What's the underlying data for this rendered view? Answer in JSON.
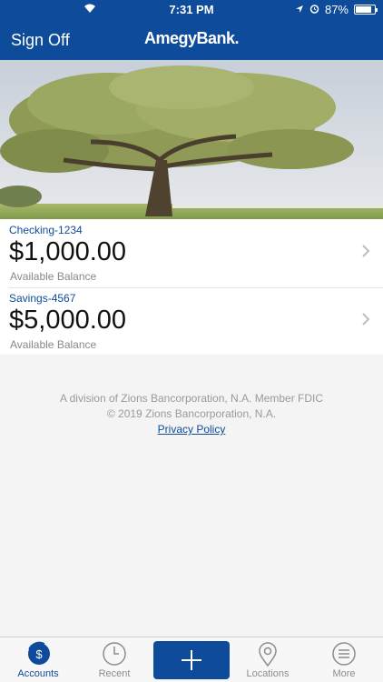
{
  "status_bar": {
    "time": "7:31 PM",
    "battery_percent": "87%",
    "battery_level": 0.87
  },
  "navbar": {
    "sign_off_label": "Sign Off",
    "logo_text": "AmegyBank."
  },
  "accounts": [
    {
      "name": "Checking-1234",
      "balance": "$1,000.00",
      "balance_label": "Available Balance"
    },
    {
      "name": "Savings-4567",
      "balance": "$5,000.00",
      "balance_label": "Available Balance"
    }
  ],
  "footer": {
    "line1": "A division of Zions Bancorporation, N.A. Member FDIC",
    "line2": "© 2019 Zions Bancorporation, N.A.",
    "privacy_link": "Privacy Policy"
  },
  "tabbar": {
    "tabs": [
      {
        "label": "Accounts",
        "icon": "dollar-circle-icon",
        "active": true
      },
      {
        "label": "Recent",
        "icon": "clock-icon",
        "active": false
      },
      {
        "label": "",
        "icon": "plus-icon",
        "active": false
      },
      {
        "label": "Locations",
        "icon": "map-pin-icon",
        "active": false
      },
      {
        "label": "More",
        "icon": "menu-icon",
        "active": false
      }
    ]
  },
  "colors": {
    "brand_blue": "#0e4b9a",
    "tab_inactive": "#8c8c8c",
    "caption_gray": "#888888"
  }
}
